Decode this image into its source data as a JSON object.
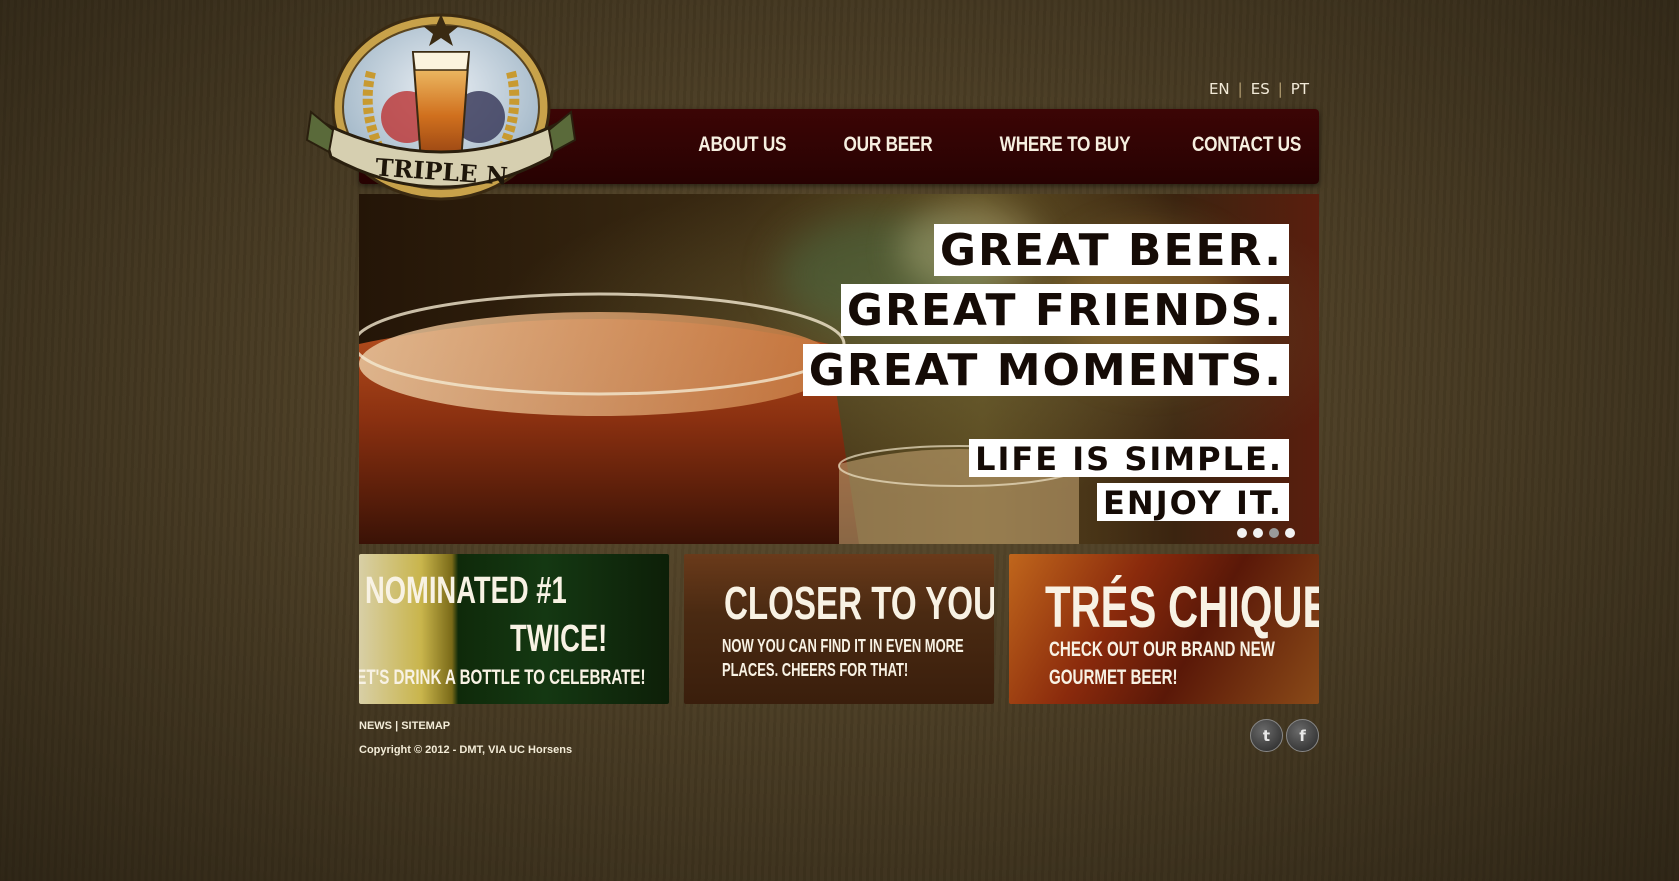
{
  "language_switch": {
    "items": [
      "EN",
      "ES",
      "PT"
    ],
    "separator": "|"
  },
  "logo": {
    "text": "TRIPLE N"
  },
  "nav": {
    "items": [
      "ABOUT US",
      "OUR BEER",
      "WHERE TO BUY",
      "CONTACT US"
    ]
  },
  "hero": {
    "lines": [
      "GREAT BEER.",
      "GREAT FRIENDS.",
      "GREAT MOMENTS.",
      "LIFE IS SIMPLE.",
      "ENJOY IT."
    ],
    "slides_total": 4,
    "active_slide": 3
  },
  "teasers": [
    {
      "title_lines": [
        "NOMINATED #1",
        "TWICE!"
      ],
      "subtitle_lines": [
        "LET'S DRINK A BOTTLE TO CELEBRATE!"
      ]
    },
    {
      "title_lines": [
        "CLOSER TO YOU"
      ],
      "subtitle_lines": [
        "NOW YOU CAN FIND IT IN EVEN MORE",
        "PLACES. CHEERS FOR THAT!"
      ]
    },
    {
      "title_lines": [
        "TRÉS CHIQUE!"
      ],
      "subtitle_lines": [
        "CHECK OUT OUR BRAND NEW",
        "GOURMET BEER!"
      ]
    }
  ],
  "footer": {
    "links": [
      "NEWS",
      "SITEMAP"
    ],
    "separator": "|",
    "copyright": "Copyright © 2012 - DMT, VIA UC Horsens",
    "social": [
      {
        "icon": "twitter-icon",
        "glyph": "t"
      },
      {
        "icon": "facebook-icon",
        "glyph": "f"
      }
    ]
  },
  "colors": {
    "background": "#4b3d24",
    "navbar": "#3c0505",
    "nav_text": "#f6efe0",
    "tag_bg": "#ffffff",
    "tag_text": "#150b06"
  }
}
